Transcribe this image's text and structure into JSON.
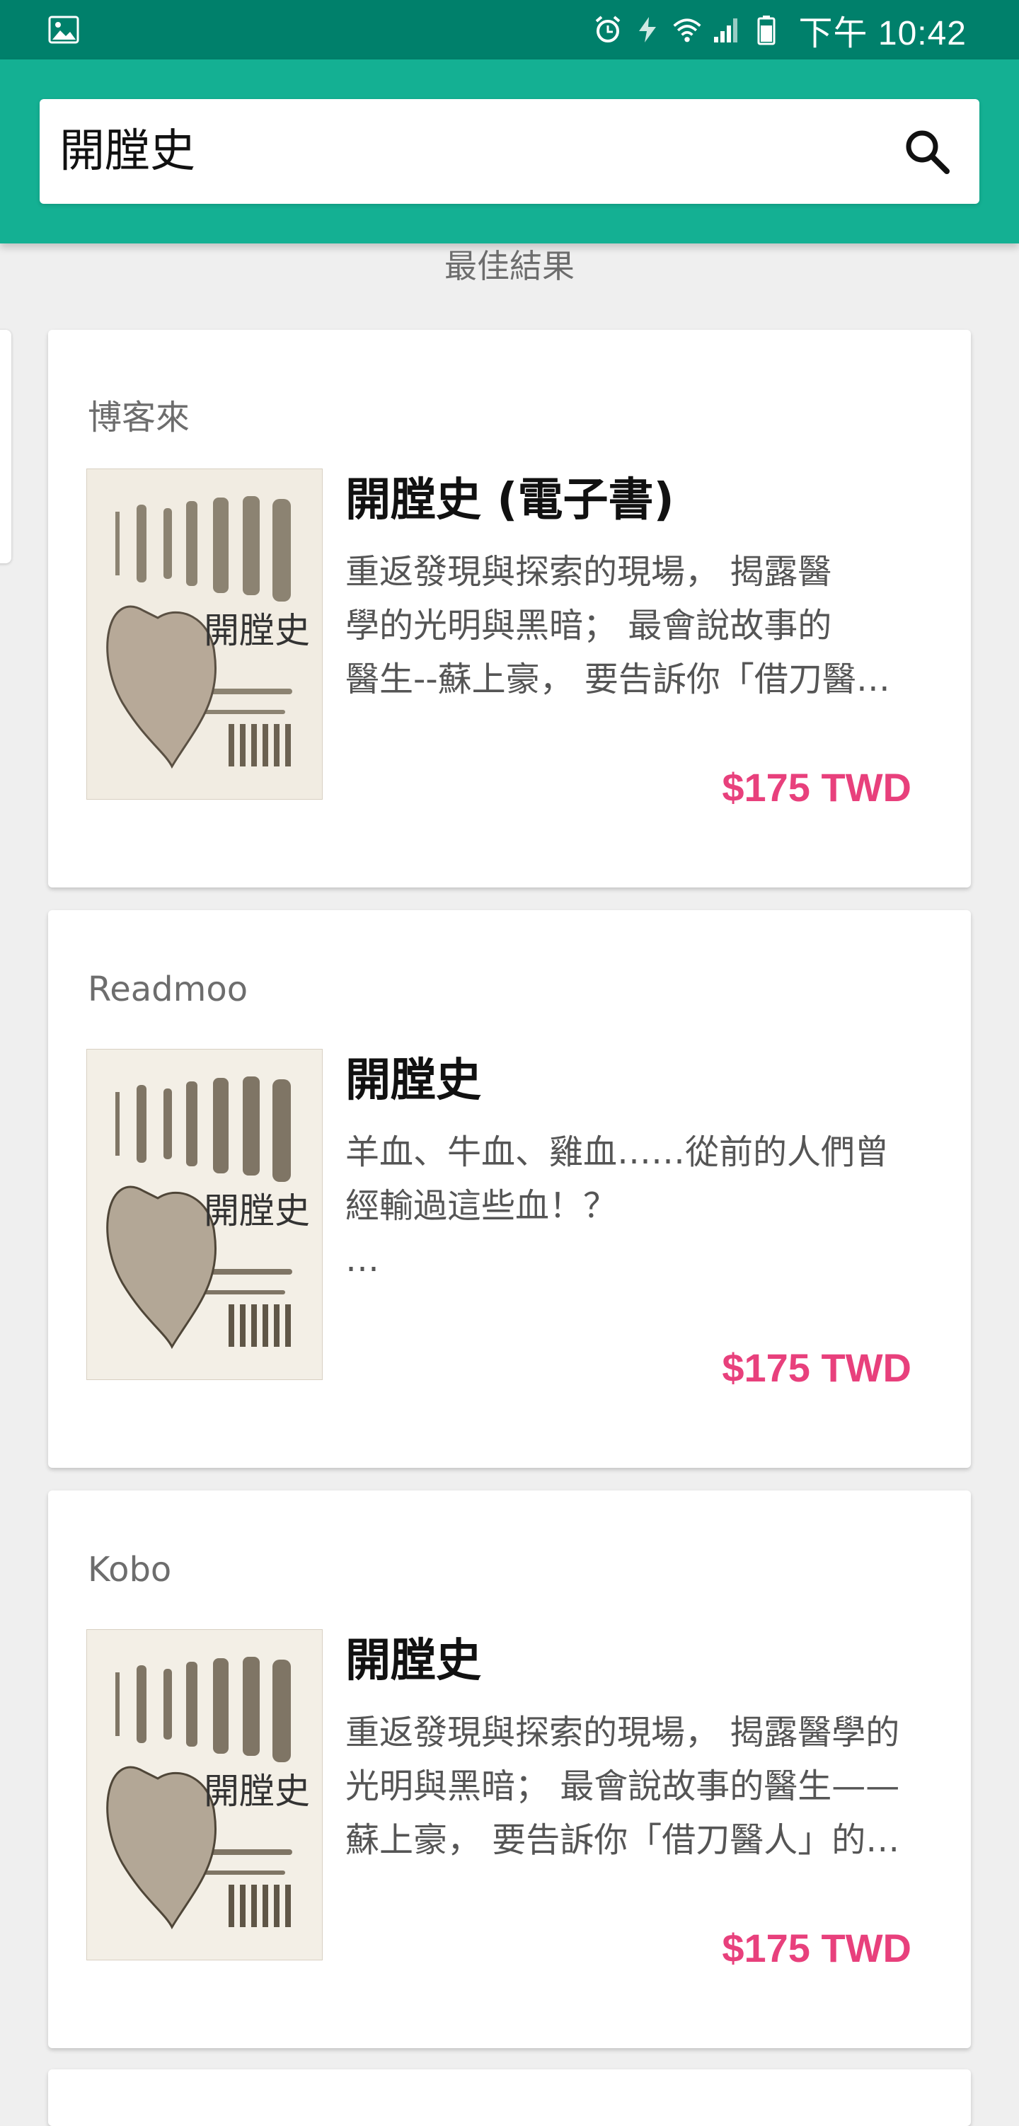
{
  "status_bar": {
    "time": "下午 10:42",
    "icons": [
      "image-icon",
      "alarm-icon",
      "power-saving-icon",
      "wifi-icon",
      "signal-icon",
      "battery-icon"
    ]
  },
  "search": {
    "query": "開膛史",
    "icon": "search-icon"
  },
  "results": {
    "section_title": "最佳結果",
    "cards": [
      {
        "store": "博客來",
        "title": "開膛史 (電子書)",
        "description": "重返發現與探索的現場， 揭露醫\n學的光明與黑暗； 最會說故事的\n醫生--蘇上豪， 要告訴你「借刀醫…",
        "price": "$175 TWD"
      },
      {
        "store": "Readmoo",
        "title": "開膛史",
        "description": "羊血、牛血、雞血……從前的人們曾\n經輸過這些血！？\n…",
        "price": "$175 TWD"
      },
      {
        "store": "Kobo",
        "title": "開膛史",
        "description": "重返發現與探索的現場， 揭露醫學的\n光明與黑暗； 最會說故事的醫生——\n蘇上豪， 要告訴你「借刀醫人」的…",
        "price": "$175 TWD"
      }
    ]
  },
  "cover_text": "開膛史",
  "colors": {
    "status_bar": "#00806b",
    "toolbar": "#14b093",
    "price": "#e8407c",
    "background": "#efefef"
  }
}
